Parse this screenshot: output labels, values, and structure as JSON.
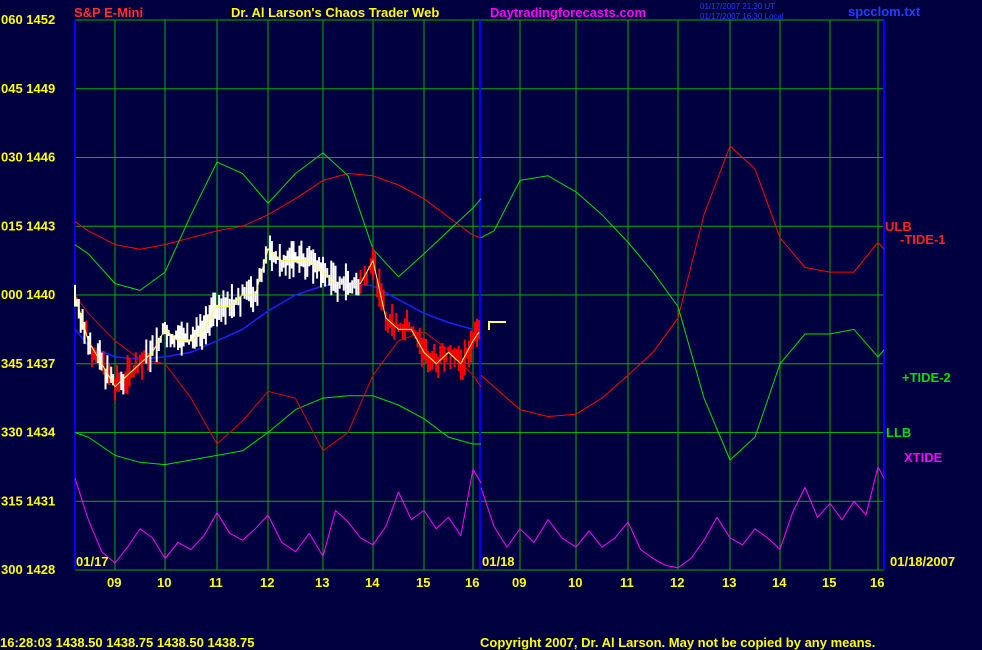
{
  "header": {
    "symbol": "S&P E-Mini",
    "title": "Dr. Al Larson's Chaos Trader Web",
    "site": "Daytradingforecasts.com",
    "stamp_line1": "01/17/2007 21:30 UT",
    "stamp_line2": "01/17/2007 16:30 Local",
    "file": "spcclom.txt"
  },
  "footer": {
    "quote": "16:28:03  1438.50  1438.75  1438.50  1438.75",
    "copyright": "Copyright 2007, Dr. Al Larson. May not be copied by any means."
  },
  "colors": {
    "background": "#000040",
    "grid": "#00B000",
    "axis_text": "#FFFF00",
    "price_up": "#FFFFFF",
    "price_down": "#FF0000",
    "ulb": "#FF0000",
    "llb": "#00E000",
    "tide1": "#E00000",
    "tide2": "#00E000",
    "xtide": "#FF00FF",
    "ma": "#2020FF",
    "smooth": "#FFFF60",
    "divider": "#0000FF"
  },
  "chart_data": {
    "type": "line",
    "title": "S&P E-Mini",
    "y_tick_labels": [
      "300 1428",
      "315 1431",
      "330 1434",
      "345 1437",
      "000 1440",
      "015 1443",
      "030 1446",
      "045 1449",
      "060 1452"
    ],
    "ylim": [
      1428,
      1452
    ],
    "x_tick_labels": [
      "09",
      "10",
      "11",
      "12",
      "13",
      "14",
      "15",
      "16",
      "09",
      "10",
      "11",
      "12",
      "13",
      "14",
      "15",
      "16"
    ],
    "date_labels": [
      "01/17",
      "01/18",
      "01/18/2007"
    ],
    "x_range": [
      8.25,
      16.25
    ],
    "series_labels": {
      "ulb": "ULB",
      "tide1": "-TIDE-1",
      "tide2": "+TIDE-2",
      "llb": "LLB",
      "xtide": "XTIDE"
    },
    "series": [
      {
        "name": "price",
        "day": 1,
        "x": [
          8.25,
          8.5,
          8.75,
          9.0,
          9.25,
          9.5,
          9.75,
          10.0,
          10.25,
          10.5,
          10.75,
          11.0,
          11.25,
          11.5,
          11.75,
          12.0,
          12.25,
          12.5,
          12.75,
          13.0,
          13.25,
          13.5,
          13.75,
          14.0,
          14.25,
          14.5,
          14.75,
          15.0,
          15.25,
          15.5,
          15.75,
          16.0,
          16.1
        ],
        "y": [
          1440,
          1438,
          1437,
          1436,
          1436.5,
          1437,
          1437.5,
          1438.5,
          1438,
          1438,
          1438.5,
          1439.5,
          1439.5,
          1440,
          1440,
          1442,
          1441.5,
          1441.5,
          1441.5,
          1441,
          1440.5,
          1440.5,
          1440.5,
          1441.5,
          1439,
          1438.5,
          1438.5,
          1437.5,
          1437,
          1437.5,
          1437,
          1438,
          1438.5
        ]
      },
      {
        "name": "ULB",
        "day": 1,
        "x": [
          8.25,
          8.5,
          9,
          9.5,
          10,
          10.5,
          11,
          11.5,
          12,
          12.5,
          13,
          13.5,
          14,
          14.5,
          15,
          15.5,
          16,
          16.1
        ],
        "y": [
          1443.2,
          1442.8,
          1442.2,
          1442,
          1442.2,
          1442.5,
          1442.8,
          1443,
          1443.5,
          1444.2,
          1445,
          1445.3,
          1445.2,
          1444.8,
          1444.2,
          1443.4,
          1442.6,
          1442.5
        ]
      },
      {
        "name": "LLB",
        "day": 1,
        "x": [
          8.25,
          8.5,
          9,
          9.5,
          10,
          10.5,
          11,
          11.5,
          12,
          12.5,
          13,
          13.5,
          14,
          14.5,
          15,
          15.5,
          16,
          16.1
        ],
        "y": [
          1434,
          1433.8,
          1433,
          1432.7,
          1432.6,
          1432.8,
          1433,
          1433.2,
          1434,
          1435,
          1435.5,
          1435.6,
          1435.6,
          1435.2,
          1434.6,
          1433.8,
          1433.5,
          1433.5
        ]
      },
      {
        "name": "-TIDE-1",
        "day": 1,
        "x": [
          8.25,
          8.5,
          9,
          9.5,
          10,
          10.5,
          11,
          11.5,
          12,
          12.5,
          13,
          13.5,
          14,
          14.5,
          15,
          15.5,
          16,
          16.1
        ],
        "y": [
          1440,
          1439.2,
          1438,
          1437.2,
          1437,
          1435.5,
          1433.5,
          1434.5,
          1435.8,
          1435.5,
          1433.2,
          1434,
          1436.5,
          1438,
          1438.4,
          1437.6,
          1436.5,
          1436
        ]
      },
      {
        "name": "+TIDE-2",
        "day": 1,
        "x": [
          8.25,
          8.5,
          9,
          9.5,
          10,
          10.5,
          11,
          11.5,
          12,
          12.5,
          13,
          13.5,
          14,
          14.5,
          15,
          15.5,
          16,
          16.1
        ],
        "y": [
          1442.2,
          1441.8,
          1440.5,
          1440.2,
          1441,
          1443.5,
          1445.8,
          1445.3,
          1444,
          1445.3,
          1446.2,
          1445.2,
          1442,
          1440.8,
          1441.8,
          1442.8,
          1443.8,
          1444.2
        ]
      },
      {
        "name": "MA",
        "day": 1,
        "x": [
          8.25,
          8.5,
          9,
          9.5,
          10,
          10.5,
          11,
          11.5,
          12,
          12.5,
          13,
          13.5,
          14,
          14.5,
          15,
          15.5,
          16,
          16.1
        ],
        "y": [
          1438.5,
          1437.8,
          1437.3,
          1437.2,
          1437.3,
          1437.5,
          1438,
          1438.5,
          1439.3,
          1440,
          1440.4,
          1440.5,
          1440.4,
          1439.8,
          1439.2,
          1438.8,
          1438.5,
          1438.4
        ]
      },
      {
        "name": "ULB",
        "day": 2,
        "x": [
          8.25,
          8.5,
          9,
          9.5,
          10,
          10.5,
          11,
          11.5,
          12,
          12.5,
          13,
          13.5,
          14,
          14.5,
          15,
          15.5,
          16,
          16.1
        ],
        "y": [
          1436.5,
          1436,
          1435,
          1434.7,
          1434.8,
          1435.5,
          1436.5,
          1437.5,
          1439,
          1443.5,
          1446.5,
          1445.5,
          1442.5,
          1441.2,
          1441,
          1441,
          1442.3,
          1442
        ]
      },
      {
        "name": "LLB",
        "day": 2,
        "x": [
          8.25,
          8.5,
          9,
          9.5,
          10,
          10.5,
          11,
          11.5,
          12,
          12.5,
          13,
          13.5,
          14,
          14.5,
          15,
          15.5,
          16,
          16.1
        ],
        "y": [
          1442.5,
          1442.8,
          1445,
          1445.2,
          1444.5,
          1443.5,
          1442.3,
          1441,
          1439.5,
          1435.5,
          1432.8,
          1433.8,
          1437,
          1438.3,
          1438.3,
          1438.5,
          1437.3,
          1437.6
        ]
      },
      {
        "name": "XTIDE",
        "day": 1,
        "x": [
          8.25,
          8.5,
          8.75,
          9,
          9.25,
          9.5,
          9.75,
          10,
          10.25,
          10.5,
          10.75,
          11,
          11.25,
          11.5,
          11.75,
          12,
          12.25,
          12.5,
          12.75,
          13,
          13.25,
          13.5,
          13.75,
          14,
          14.25,
          14.5,
          14.75,
          15,
          15.25,
          15.5,
          15.75,
          16,
          16.1
        ],
        "y": [
          1432,
          1430.2,
          1428.8,
          1428.3,
          1429,
          1429.8,
          1429.4,
          1428.5,
          1429.2,
          1428.9,
          1429.5,
          1430.5,
          1429.6,
          1429.3,
          1429.8,
          1430.4,
          1429.2,
          1428.8,
          1429.6,
          1428.6,
          1430.6,
          1430.1,
          1429.4,
          1429.1,
          1429.9,
          1431.4,
          1430.2,
          1430.6,
          1429.8,
          1430.3,
          1429.5,
          1432.4,
          1431.8
        ]
      },
      {
        "name": "XTIDE",
        "day": 2,
        "x": [
          8.25,
          8.5,
          8.75,
          9,
          9.25,
          9.5,
          9.75,
          10,
          10.25,
          10.5,
          10.75,
          11,
          11.25,
          11.5,
          11.75,
          12,
          12.25,
          12.5,
          12.75,
          13,
          13.25,
          13.5,
          13.75,
          14,
          14.25,
          14.5,
          14.75,
          15,
          15.25,
          15.5,
          15.75,
          16,
          16.1
        ],
        "y": [
          1431.6,
          1429.9,
          1429,
          1429.8,
          1429.2,
          1430.2,
          1429.4,
          1429,
          1429.7,
          1429,
          1429.4,
          1430.1,
          1428.9,
          1428.5,
          1428.2,
          1428.1,
          1428.5,
          1429.3,
          1430.3,
          1429.4,
          1429.1,
          1429.8,
          1429.4,
          1428.9,
          1430.5,
          1431.6,
          1430.3,
          1430.9,
          1430.2,
          1431,
          1430.4,
          1432.5,
          1432
        ]
      }
    ]
  }
}
